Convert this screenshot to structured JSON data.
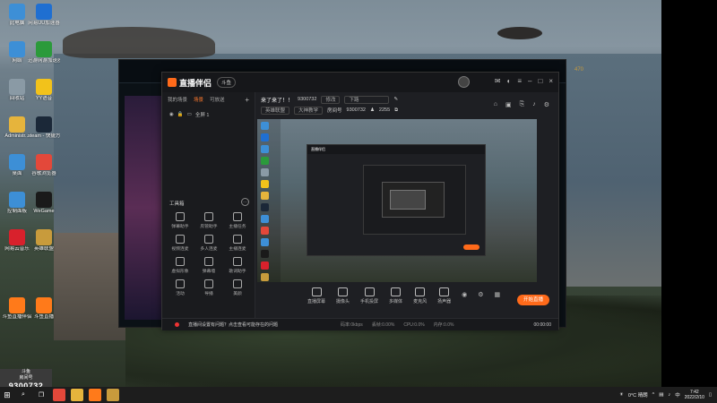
{
  "desktop_icons": [
    {
      "label": "此电脑",
      "icon": "computer-icon",
      "color": "#3d8fd6"
    },
    {
      "label": "网易UU加速器",
      "icon": "uu-accelerator-icon",
      "color": "#1f6fd1"
    },
    {
      "label": "网络",
      "icon": "network-icon",
      "color": "#3d8fd6"
    },
    {
      "label": "迅游网游加速器",
      "icon": "xunyou-icon",
      "color": "#2b9a3b"
    },
    {
      "label": "回收站",
      "icon": "recycle-bin-icon",
      "color": "#8a9aa5"
    },
    {
      "label": "YY语音",
      "icon": "yy-icon",
      "color": "#f2c21b"
    },
    {
      "label": "Administr...",
      "icon": "user-folder-icon",
      "color": "#e6b43c"
    },
    {
      "label": "steam - 快捷方式",
      "icon": "steam-icon",
      "color": "#1b2838"
    },
    {
      "label": "桌面",
      "icon": "desktop-folder-icon",
      "color": "#3d8fd6"
    },
    {
      "label": "谷歌浏览器",
      "icon": "chrome-icon",
      "color": "#e3483a"
    },
    {
      "label": "控制面板",
      "icon": "control-panel-icon",
      "color": "#3d8fd6"
    },
    {
      "label": "WeGame",
      "icon": "wegame-icon",
      "color": "#1a1a1a"
    },
    {
      "label": "网易云音乐",
      "icon": "netease-music-icon",
      "color": "#d8212c"
    },
    {
      "label": "英雄联盟",
      "icon": "lol-icon",
      "color": "#c89b3c"
    },
    {
      "label": "斗鱼直播伴侣",
      "icon": "douyu-companion-icon",
      "color": "#ff7a1a"
    },
    {
      "label": "斗鱼直播",
      "icon": "douyu-icon",
      "color": "#ff7a1a"
    }
  ],
  "lol_client": {
    "gold": "470",
    "icons": [
      "play-icon",
      "profile-icon"
    ]
  },
  "app": {
    "name": "直播伴侣",
    "badge": "斗鱼",
    "left_tabs": [
      "我的场景",
      "场景",
      "可放送"
    ],
    "scene_label": "全屏 1",
    "tools_title": "工具箱",
    "tools": [
      "弹幕助手",
      "房管助手",
      "主播任务",
      "视频连麦",
      "多人连麦",
      "主播连麦",
      "虚拟形象",
      "弹幕墙",
      "歌词助手",
      "活动",
      "导播",
      "美颜"
    ],
    "stream_title": "来了来了！！",
    "room_id": "9300732",
    "edit_label": "修改",
    "category": "下路",
    "tags": [
      "英雄联盟",
      "大神教学"
    ],
    "room_label": "房间号",
    "room_value": "9300732",
    "fans_count": "2255",
    "toolbar": [
      "直播屏幕",
      "摄像头",
      "手机投屏",
      "多媒体",
      "麦克风",
      "扬声器"
    ],
    "go_live": "开始直播",
    "status_tip": "直播间设置有问题？点击查看可能存在的问题",
    "status_items": [
      "码率:0kbps",
      "丢帧:0.00%",
      "CPU:0.0%",
      "内存:0.0%"
    ],
    "timer": "00:00:00"
  },
  "douyu_panel": {
    "title": "斗鱼",
    "subtitle": "房间号",
    "room_number": "9300732"
  },
  "taskbar": {
    "weather": "0°C 晴朗",
    "ime": "中",
    "time": "7:42",
    "date": "2022/2/10"
  }
}
